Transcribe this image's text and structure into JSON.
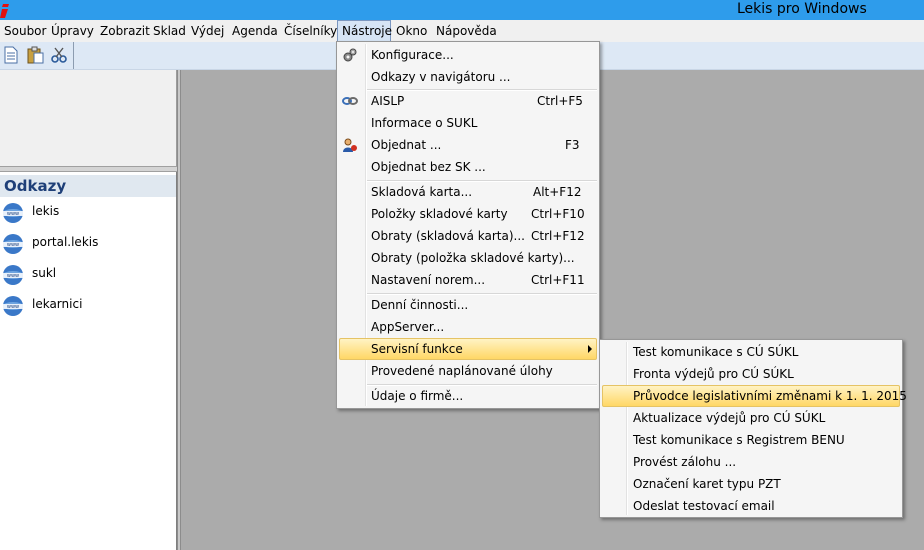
{
  "window": {
    "title": "Lekis pro Windows",
    "accent": "#2e9ceb"
  },
  "menubar": {
    "items": [
      "Soubor",
      "Úpravy",
      "Zobrazit",
      "Sklad",
      "Výdej",
      "Agenda",
      "Číselníky",
      "Nástroje",
      "Okno",
      "Nápověda"
    ],
    "active": "Nástroje"
  },
  "toolbar": {
    "icons": [
      "new-document-icon",
      "paste-icon",
      "cut-icon"
    ]
  },
  "links_panel": {
    "title": "Odkazy",
    "items": [
      "lekis",
      "portal.lekis",
      "sukl",
      "lekarnici"
    ]
  },
  "tools_menu": {
    "items": [
      {
        "label": "Konfigurace...",
        "shortcut": "",
        "icon": "gears-icon"
      },
      {
        "label": "Odkazy v navigátoru ...",
        "shortcut": ""
      },
      {
        "label": "AISLP",
        "shortcut": "Ctrl+F5",
        "icon": "link-icon"
      },
      {
        "label": "Informace o SUKL",
        "shortcut": ""
      },
      {
        "label": "Objednat ...",
        "shortcut": "F3",
        "icon": "person-icon"
      },
      {
        "label": "Objednat bez SK ...",
        "shortcut": ""
      },
      {
        "label": "Skladová karta...",
        "shortcut": "Alt+F12"
      },
      {
        "label": "Položky skladové karty",
        "shortcut": "Ctrl+F10"
      },
      {
        "label": "Obraty (skladová karta)...",
        "shortcut": "Ctrl+F12"
      },
      {
        "label": "Obraty (položka skladové karty)...",
        "shortcut": ""
      },
      {
        "label": "Nastavení norem...",
        "shortcut": "Ctrl+F11"
      },
      {
        "label": "Denní činnosti...",
        "shortcut": ""
      },
      {
        "label": "AppServer...",
        "shortcut": ""
      },
      {
        "label": "Servisní funkce",
        "shortcut": "",
        "submenu": true
      },
      {
        "label": "Provedené naplánované úlohy",
        "shortcut": ""
      },
      {
        "label": "Údaje o firmě...",
        "shortcut": ""
      }
    ]
  },
  "service_submenu": {
    "items": [
      "Test komunikace s CÚ SÚKL",
      "Fronta výdejů pro CÚ SÚKL",
      "Průvodce legislativními změnami k 1. 1. 2015",
      "Aktualizace výdejů pro CÚ SÚKL",
      "Test komunikace s Registrem BENU",
      "Provést zálohu ...",
      "Označení karet typu PZT",
      "Odeslat testovací email"
    ],
    "highlighted": "Průvodce legislativními změnami k 1. 1. 2015"
  }
}
